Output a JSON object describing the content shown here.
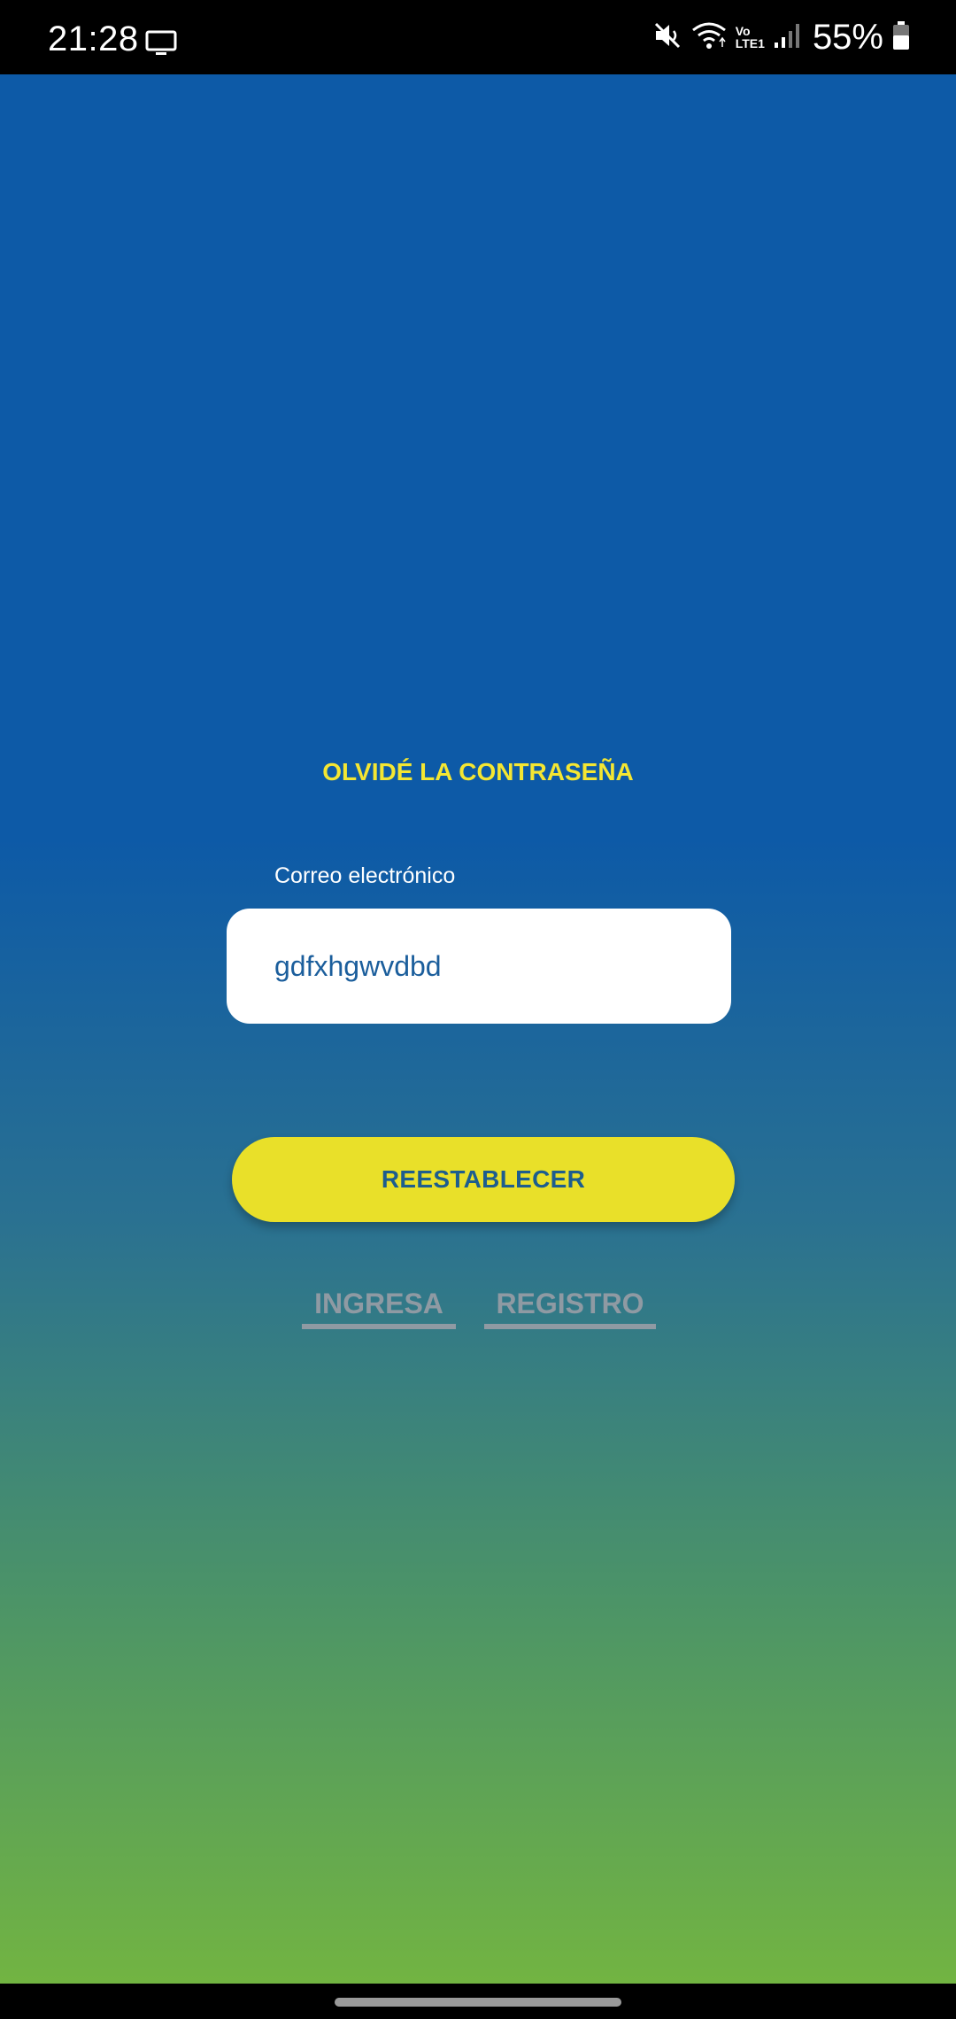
{
  "status_bar": {
    "time": "21:28",
    "left_icon": "screen-cast-icon",
    "icons": [
      "mute-icon",
      "wifi-icon",
      "signal-icon",
      "battery-icon"
    ],
    "vo_text": "Vo",
    "lte_text": "LTE1",
    "battery_percent": "55%"
  },
  "form": {
    "title": "OLVIDÉ LA CONTRASEÑA",
    "email_label": "Correo electrónico",
    "email_value": "gdfxhgwvdbd",
    "submit_label": "REESTABLECER"
  },
  "links": {
    "login_label": "INGRESA",
    "register_label": "REGISTRO"
  },
  "colors": {
    "gradient_top": "#0d5aa7",
    "gradient_bottom": "#72b442",
    "accent_yellow": "#e9e029",
    "title_yellow": "#f4e632",
    "link_gray": "#8f9aa3"
  }
}
